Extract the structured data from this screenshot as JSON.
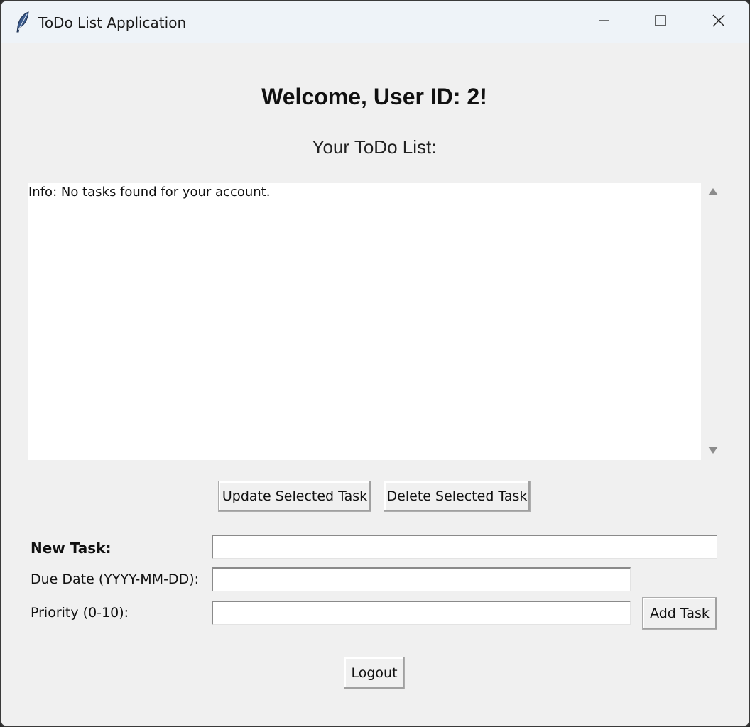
{
  "window": {
    "title": "ToDo List Application"
  },
  "main": {
    "welcome": "Welcome, User ID: 2!",
    "subheading": "Your ToDo List:",
    "list_items": [
      "Info: No tasks found for your account."
    ]
  },
  "actions": {
    "update_label": "Update Selected Task",
    "delete_label": "Delete Selected Task"
  },
  "form": {
    "task_label": "New Task:",
    "task_value": "",
    "due_label": "Due Date (YYYY-MM-DD):",
    "due_value": "",
    "priority_label": "Priority (0-10):",
    "priority_value": "",
    "add_label": "Add Task"
  },
  "footer": {
    "logout_label": "Logout"
  },
  "icons": {
    "app": "feather-icon",
    "minimize": "minimize-icon",
    "maximize": "maximize-icon",
    "close": "close-icon",
    "scroll_up": "scroll-up-arrow-icon",
    "scroll_down": "scroll-down-arrow-icon"
  }
}
